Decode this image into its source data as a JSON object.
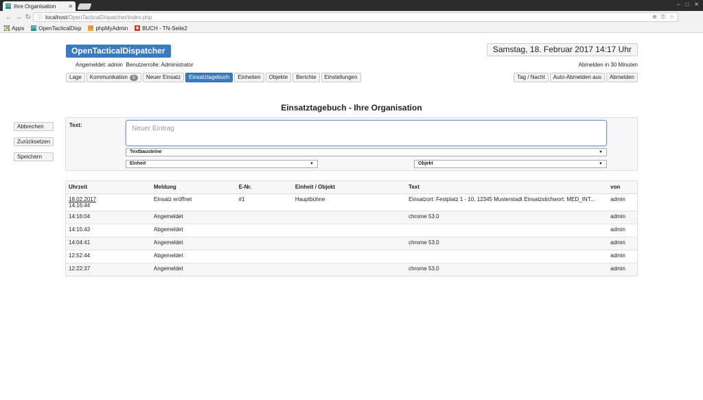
{
  "browser": {
    "tab_title": "Ihre Organisation",
    "tab_favicon": "OTD",
    "url_host": "localhost",
    "url_path": "/OpenTacticalDispatcher/index.php",
    "bookmarks": [
      {
        "label": "Apps"
      },
      {
        "label": "OpenTacticalDisp"
      },
      {
        "label": "phpMyAdmin"
      },
      {
        "label": "BUCH - TN-Seite2"
      }
    ]
  },
  "header": {
    "brand": "OpenTacticalDispatcher",
    "clock": "Samstag, 18. Februar 2017 14:17 Uhr",
    "login_info": "Angemeldet: admin  Benutzerrolle: Administrator",
    "logout_timer": "Abmelden in 30 Minuten"
  },
  "nav": {
    "lage": "Lage",
    "kommunikation": "Kommunikation",
    "kommunikation_count": "0",
    "neuer_einsatz": "Neuer Einsatz",
    "einsatztagebuch": "Einsatztagebuch",
    "einheiten": "Einheiten",
    "objekte": "Objekte",
    "berichte": "Berichte",
    "einstellungen": "Einstellungen",
    "tag_nacht": "Tag / Nacht",
    "auto_abmelden": "Auto-Abmelden aus",
    "abmelden": "Abmelden"
  },
  "page_title": "Einsatztagebuch - Ihre Organisation",
  "side_actions": {
    "abbrechen": "Abbrechen",
    "zuruecksetzen": "Zurücksetzen",
    "speichern": "Speichern"
  },
  "form": {
    "text_label": "Text:",
    "entry_placeholder": "Neuer Eintrag",
    "textbausteine": "Textbausteine",
    "einheit": "Einheit",
    "objekt": "Objekt"
  },
  "log_table": {
    "columns": [
      "Uhrzeit",
      "Meldung",
      "E-Nr.",
      "Einheit / Objekt",
      "Text",
      "von"
    ],
    "rows": [
      {
        "date": "18.02.2017",
        "time": "14:16:44",
        "meldung": "Einsatz eröffnet",
        "enr": "#1",
        "einheit": "Hauptbühne",
        "text": "Einsatzort: Festplatz 1 - 10, 12345 Musterstadt Einsatzstichwort: MED_INT...",
        "von": "admin"
      },
      {
        "date": "",
        "time": "14:16:04",
        "meldung": "Angemeldet",
        "enr": "",
        "einheit": "",
        "text": "chrome 53.0",
        "von": "admin"
      },
      {
        "date": "",
        "time": "14:15:43",
        "meldung": "Abgemeldet",
        "enr": "",
        "einheit": "",
        "text": "",
        "von": "admin"
      },
      {
        "date": "",
        "time": "14:04:41",
        "meldung": "Angemeldet",
        "enr": "",
        "einheit": "",
        "text": "chrome 53.0",
        "von": "admin"
      },
      {
        "date": "",
        "time": "12:52:44",
        "meldung": "Abgemeldet",
        "enr": "",
        "einheit": "",
        "text": "",
        "von": "admin"
      },
      {
        "date": "",
        "time": "12:22:37",
        "meldung": "Angemeldet",
        "enr": "",
        "einheit": "",
        "text": "chrome 53.0",
        "von": "admin"
      }
    ]
  },
  "colors": {
    "accent": "#3a7ac0",
    "panel_bg": "#f7f7f7",
    "border": "#dcdcdc"
  }
}
